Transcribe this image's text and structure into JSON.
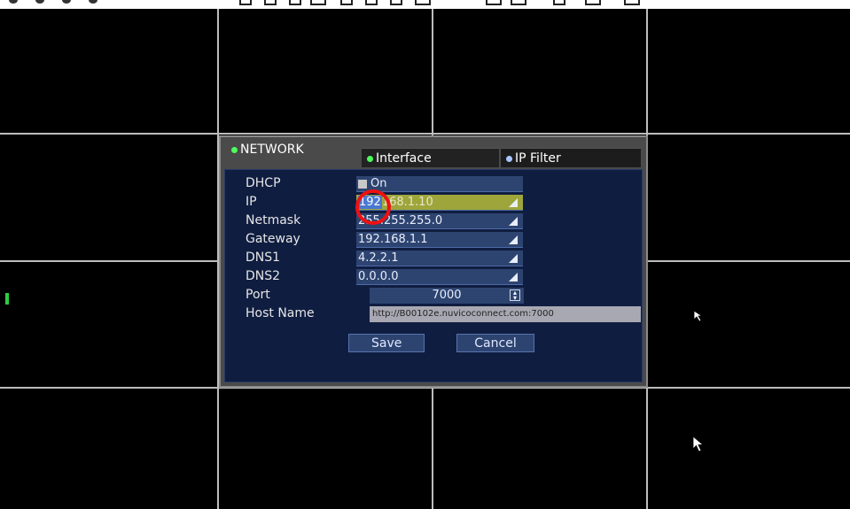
{
  "toolbar": {
    "icons": [
      "dot-icon",
      "dot-icon",
      "dot-icon",
      "dot-icon",
      "window-icon",
      "window-icon",
      "window-icon",
      "window-icon",
      "window-icon",
      "window-icon",
      "window-icon",
      "window-icon",
      "window-icon",
      "window-icon",
      "window-icon",
      "window-icon"
    ]
  },
  "dialog": {
    "section_title": "NETWORK",
    "tabs": [
      {
        "label": "Interface",
        "active": true
      },
      {
        "label": "IP Filter",
        "active": false
      }
    ],
    "fields": {
      "dhcp": {
        "label": "DHCP",
        "value": "On",
        "checked": true
      },
      "ip": {
        "label": "IP",
        "value_selected": "192",
        "value_rest": "168.1.10"
      },
      "netmask": {
        "label": "Netmask",
        "value": "255.255.255.0"
      },
      "gateway": {
        "label": "Gateway",
        "value": "192.168.1.1"
      },
      "dns1": {
        "label": "DNS1",
        "value": "4.2.2.1"
      },
      "dns2": {
        "label": "DNS2",
        "value": "0.0.0.0"
      },
      "port": {
        "label": "Port",
        "value": "7000"
      },
      "host_name": {
        "label": "Host Name",
        "value": "http://B00102e.nuvicoconnect.com:7000"
      }
    },
    "buttons": {
      "save": "Save",
      "cancel": "Cancel"
    }
  },
  "colors": {
    "dialog_bg": "#0f1d40",
    "field_bg": "#2e4470",
    "ip_field_bg": "#9ea63b",
    "selection": "#4a78d0",
    "highlight_circle": "#ee1111",
    "grid_line": "#bdbdbd"
  }
}
